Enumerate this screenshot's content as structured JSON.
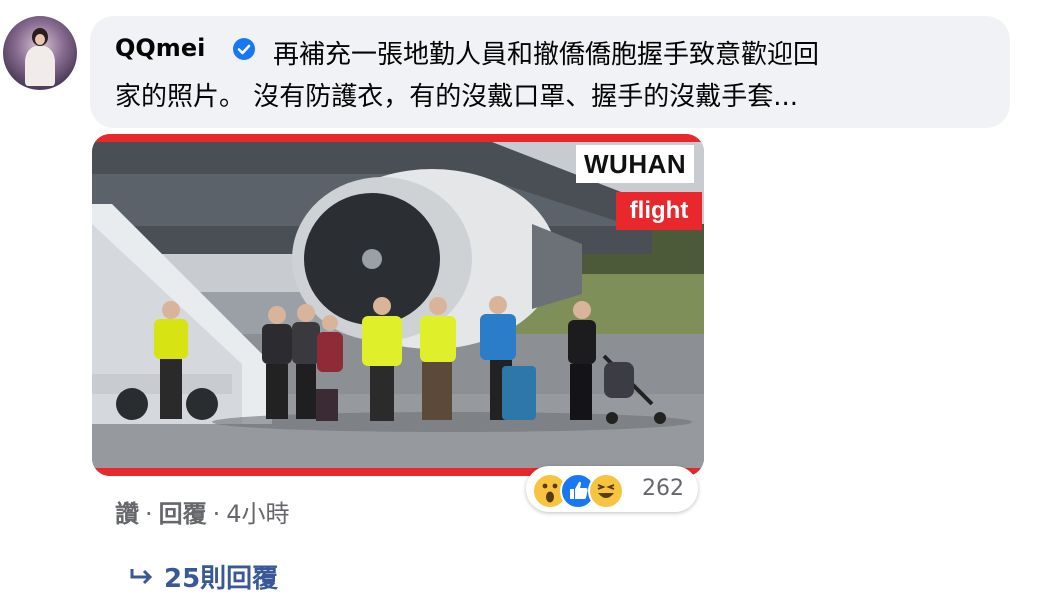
{
  "comment": {
    "author": "QQmei",
    "text": "再補充一張地勤人員和撤僑僑胞握手致意歡迎回家的照片。 沒有防護衣，有的沒戴口罩、握手的沒戴手套...",
    "text_line1": "再補充一張地勤人員和撤僑僑胞握手致意歡迎回",
    "text_line2": "家的照片。 沒有防護衣，有的沒戴口罩、握手的沒戴手套..."
  },
  "photo": {
    "tag_top": "WUHAN",
    "tag_bottom": "flight",
    "accent_color": "#e8282d"
  },
  "reactions": {
    "icons": [
      "wow-icon",
      "like-icon",
      "haha-icon"
    ],
    "count": "262"
  },
  "actions": {
    "like": "讚",
    "separator": "·",
    "reply": "回覆",
    "time": "4小時"
  },
  "replies": {
    "label": "25則回覆",
    "icon": "reply-arrow-icon"
  },
  "colors": {
    "bubble_bg": "#f0f2f5",
    "link_blue": "#385898",
    "verified_blue": "#1877f2",
    "meta_gray": "#65676b"
  }
}
